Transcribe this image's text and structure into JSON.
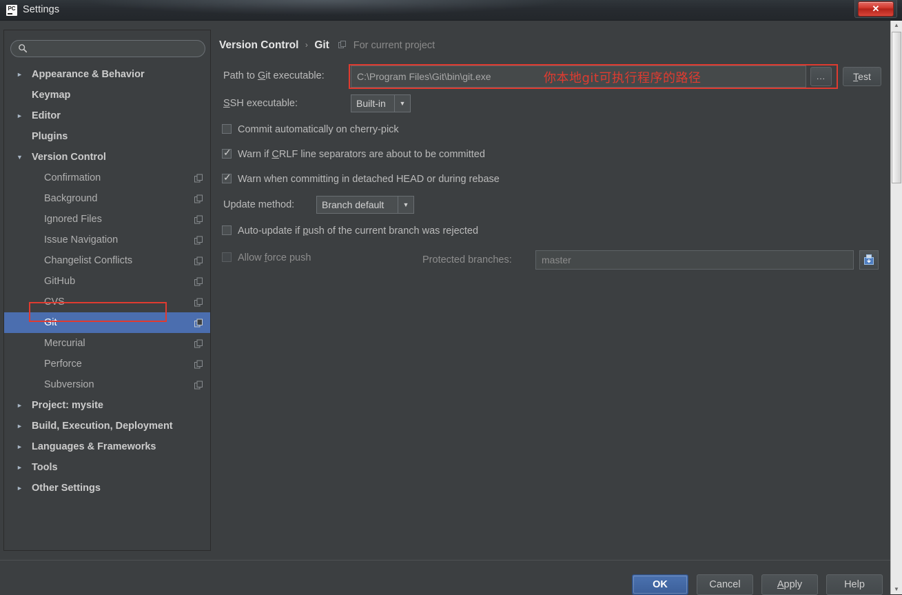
{
  "window": {
    "title": "Settings",
    "app_icon": "pycharm-icon",
    "close_label": "✕"
  },
  "search": {
    "value": "",
    "placeholder": "",
    "icon": "search-icon"
  },
  "sidebar": {
    "items": [
      {
        "label": "Appearance & Behavior",
        "level": "top",
        "expandable": true,
        "expanded": false,
        "scope_icon": false
      },
      {
        "label": "Keymap",
        "level": "top",
        "expandable": false,
        "expanded": false,
        "scope_icon": false
      },
      {
        "label": "Editor",
        "level": "top",
        "expandable": true,
        "expanded": false,
        "scope_icon": false
      },
      {
        "label": "Plugins",
        "level": "top",
        "expandable": false,
        "expanded": false,
        "scope_icon": false
      },
      {
        "label": "Version Control",
        "level": "top",
        "expandable": true,
        "expanded": true,
        "scope_icon": false
      },
      {
        "label": "Confirmation",
        "level": "child",
        "expandable": false,
        "expanded": false,
        "scope_icon": true
      },
      {
        "label": "Background",
        "level": "child",
        "expandable": false,
        "expanded": false,
        "scope_icon": true
      },
      {
        "label": "Ignored Files",
        "level": "child",
        "expandable": false,
        "expanded": false,
        "scope_icon": true
      },
      {
        "label": "Issue Navigation",
        "level": "child",
        "expandable": false,
        "expanded": false,
        "scope_icon": true
      },
      {
        "label": "Changelist Conflicts",
        "level": "child",
        "expandable": false,
        "expanded": false,
        "scope_icon": true
      },
      {
        "label": "GitHub",
        "level": "child",
        "expandable": false,
        "expanded": false,
        "scope_icon": true
      },
      {
        "label": "CVS",
        "level": "child",
        "expandable": false,
        "expanded": false,
        "scope_icon": true
      },
      {
        "label": "Git",
        "level": "child",
        "expandable": false,
        "expanded": false,
        "scope_icon": true,
        "selected": true
      },
      {
        "label": "Mercurial",
        "level": "child",
        "expandable": false,
        "expanded": false,
        "scope_icon": true
      },
      {
        "label": "Perforce",
        "level": "child",
        "expandable": false,
        "expanded": false,
        "scope_icon": true
      },
      {
        "label": "Subversion",
        "level": "child",
        "expandable": false,
        "expanded": false,
        "scope_icon": true
      },
      {
        "label": "Project: mysite",
        "level": "top",
        "expandable": true,
        "expanded": false,
        "scope_icon": false
      },
      {
        "label": "Build, Execution, Deployment",
        "level": "top",
        "expandable": true,
        "expanded": false,
        "scope_icon": false
      },
      {
        "label": "Languages & Frameworks",
        "level": "top",
        "expandable": true,
        "expanded": false,
        "scope_icon": false
      },
      {
        "label": "Tools",
        "level": "top",
        "expandable": true,
        "expanded": false,
        "scope_icon": false
      },
      {
        "label": "Other Settings",
        "level": "top",
        "expandable": true,
        "expanded": false,
        "scope_icon": false
      }
    ]
  },
  "breadcrumb": {
    "root": "Version Control",
    "separator": "›",
    "current": "Git",
    "scope_note": "For current project",
    "scope_icon": "project-scope-icon"
  },
  "git_settings": {
    "path_label_pre": "Path to ",
    "path_label_mn": "G",
    "path_label_post": "it executable:",
    "path_value": "C:\\Program Files\\Git\\bin\\git.exe",
    "browse_label": "...",
    "test_label_mn": "T",
    "test_label_post": "est",
    "ssh_label_mn": "S",
    "ssh_label_post": "SH executable:",
    "ssh_value": "Built-in",
    "ssh_arrow": "▼",
    "cb_cherrypick": {
      "label": "Commit automatically on cherry-pick",
      "checked": false
    },
    "cb_crlf_pre": "Warn if ",
    "cb_crlf_mn": "C",
    "cb_crlf_post": "RLF line separators are about to be committed",
    "cb_crlf_checked": true,
    "cb_detached": {
      "label": "Warn when committing in detached HEAD or during rebase",
      "checked": true
    },
    "update_label": "Update method:",
    "update_value": "Branch default",
    "update_arrow": "▼",
    "cb_autoupdate_pre": "Auto-update if ",
    "cb_autoupdate_mn": "p",
    "cb_autoupdate_post": "ush of the current branch was rejected",
    "cb_autoupdate_checked": false,
    "cb_force_pre": "Allow ",
    "cb_force_mn": "f",
    "cb_force_post": "orce push",
    "cb_force_checked": false,
    "protected_label": "Protected branches:",
    "protected_value": "master",
    "protected_expand_icon": "expand-editor-icon"
  },
  "annotations": {
    "path_note": "你本地git可执行程序的路径",
    "color": "#e03b30"
  },
  "dialog_buttons": {
    "ok": "OK",
    "cancel": "Cancel",
    "apply_mn": "A",
    "apply_post": "pply",
    "help": "Help"
  },
  "colors": {
    "panel_bg": "#3c3f41",
    "selection": "#4b6eaf",
    "accent": "#4b72b0",
    "annotation_red": "#e03b30"
  }
}
